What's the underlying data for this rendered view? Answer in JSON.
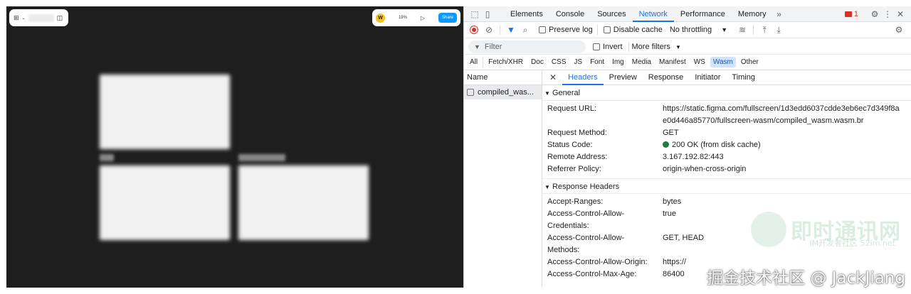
{
  "figma": {
    "share_label": "Share",
    "zoom": "19%",
    "avatar_letter": "W"
  },
  "devtools": {
    "tabs": [
      "Elements",
      "Console",
      "Sources",
      "Network",
      "Performance",
      "Memory"
    ],
    "active_tab": "Network",
    "error_count": "1",
    "toolbar": {
      "preserve_log": "Preserve log",
      "disable_cache": "Disable cache",
      "throttling": "No throttling"
    },
    "filter": {
      "placeholder": "Filter",
      "invert": "Invert",
      "more_filters": "More filters"
    },
    "types": [
      "All",
      "Fetch/XHR",
      "Doc",
      "CSS",
      "JS",
      "Font",
      "Img",
      "Media",
      "Manifest",
      "WS",
      "Wasm",
      "Other"
    ],
    "active_type": "Wasm",
    "name_header": "Name",
    "request_name": "compiled_was...",
    "detail_tabs": [
      "Headers",
      "Preview",
      "Response",
      "Initiator",
      "Timing"
    ],
    "active_detail_tab": "Headers",
    "general": {
      "title": "General",
      "request_url_key": "Request URL:",
      "request_url_line1": "https://static.figma.com/fullscreen/1d3edd6037cdde3eb6ec7d349f8a",
      "request_url_line2": "e0d446a85770/fullscreen-wasm/compiled_wasm.wasm.br",
      "method_key": "Request Method:",
      "method_val": "GET",
      "status_key": "Status Code:",
      "status_val": "200 OK (from disk cache)",
      "remote_key": "Remote Address:",
      "remote_val": "3.167.192.82:443",
      "referrer_key": "Referrer Policy:",
      "referrer_val": "origin-when-cross-origin"
    },
    "response_headers": {
      "title": "Response Headers",
      "ranges_key": "Accept-Ranges:",
      "ranges_val": "bytes",
      "creds_key1": "Access-Control-Allow-",
      "creds_key2": "Credentials:",
      "creds_val": "true",
      "methods_key1": "Access-Control-Allow-",
      "methods_key2": "Methods:",
      "methods_val": "GET, HEAD",
      "origin_key": "Access-Control-Allow-Origin:",
      "origin_val": "https://",
      "maxage_key": "Access-Control-Max-Age:",
      "maxage_val": "86400"
    }
  },
  "watermark": {
    "brand": "即时通讯网",
    "sub": "IM开发者社区 52im.net",
    "credit": "掘金技术社区 @ JackJiang"
  }
}
